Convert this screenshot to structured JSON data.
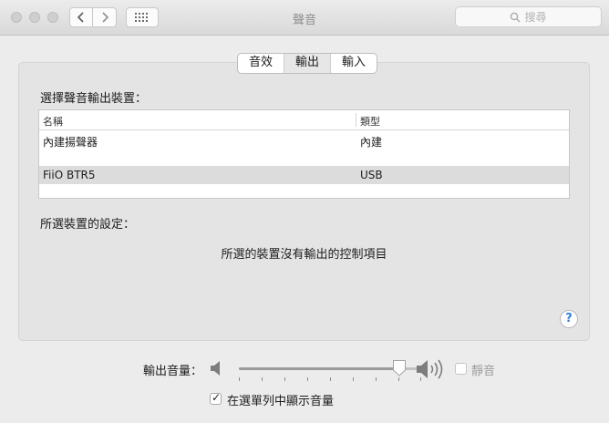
{
  "window": {
    "title": "聲音",
    "search_placeholder": "搜尋"
  },
  "toolbar": {
    "back_icon": "chevron-left-icon",
    "forward_icon": "chevron-right-icon",
    "show_all_icon": "grid-icon"
  },
  "tabs": [
    {
      "label": "音效",
      "selected": false
    },
    {
      "label": "輸出",
      "selected": true
    },
    {
      "label": "輸入",
      "selected": false
    }
  ],
  "output": {
    "select_label": "選擇聲音輸出裝置：",
    "columns": [
      "名稱",
      "類型"
    ],
    "devices": [
      {
        "name": "內建揚聲器",
        "type": "內建",
        "selected": false
      },
      {
        "name": "FiiO BTR5",
        "type": "USB",
        "selected": true
      }
    ],
    "settings_label": "所選裝置的設定：",
    "no_controls_message": "所選的裝置沒有輸出的控制項目"
  },
  "volume": {
    "label": "輸出音量：",
    "level_fraction": 0.88,
    "mute_label": "靜音",
    "mute_checked": false,
    "show_in_menubar_label": "在選單列中顯示音量",
    "show_in_menubar_checked": true
  },
  "help": {
    "glyph": "?"
  },
  "colors": {
    "help_accent": "#2f7fd8",
    "selected_row": "#dcdcdc"
  }
}
